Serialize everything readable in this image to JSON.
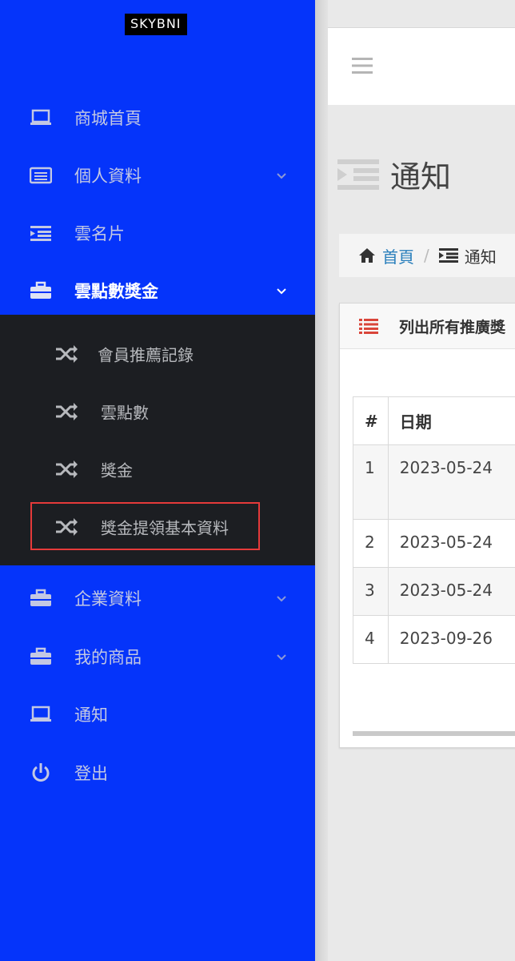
{
  "brand": "SKYBNI",
  "sidebar": {
    "items": [
      {
        "label": "商城首頁",
        "icon": "laptop-icon"
      },
      {
        "label": "個人資料",
        "icon": "id-card-icon",
        "has_children": true
      },
      {
        "label": "雲名片",
        "icon": "indent-list-icon"
      },
      {
        "label": "雲點數獎金",
        "icon": "briefcase-icon",
        "has_children": true,
        "expanded": true
      },
      {
        "label": "企業資料",
        "icon": "briefcase-icon",
        "has_children": true
      },
      {
        "label": "我的商品",
        "icon": "briefcase-icon",
        "has_children": true
      },
      {
        "label": "通知",
        "icon": "laptop-icon"
      },
      {
        "label": "登出",
        "icon": "power-icon"
      }
    ],
    "submenu": [
      {
        "label": "會員推薦記錄",
        "icon": "shuffle-icon"
      },
      {
        "label": "雲點數",
        "icon": "shuffle-icon"
      },
      {
        "label": "獎金",
        "icon": "shuffle-icon"
      },
      {
        "label": "獎金提領基本資料",
        "icon": "shuffle-icon",
        "highlighted": true
      }
    ]
  },
  "page": {
    "title": "通知",
    "breadcrumb": {
      "home": "首頁",
      "separator": "/",
      "current": "通知"
    },
    "panel_title": "列出所有推廣獎",
    "table": {
      "headers": [
        "#",
        "日期"
      ],
      "rows": [
        {
          "num": "1",
          "date": "2023-05-24"
        },
        {
          "num": "2",
          "date": "2023-05-24"
        },
        {
          "num": "3",
          "date": "2023-05-24"
        },
        {
          "num": "4",
          "date": "2023-09-26"
        }
      ]
    }
  },
  "colors": {
    "sidebar_bg": "#0534fa",
    "submenu_bg": "#1c1e22",
    "highlight_border": "#e53a3a",
    "link": "#2a7fbc"
  }
}
